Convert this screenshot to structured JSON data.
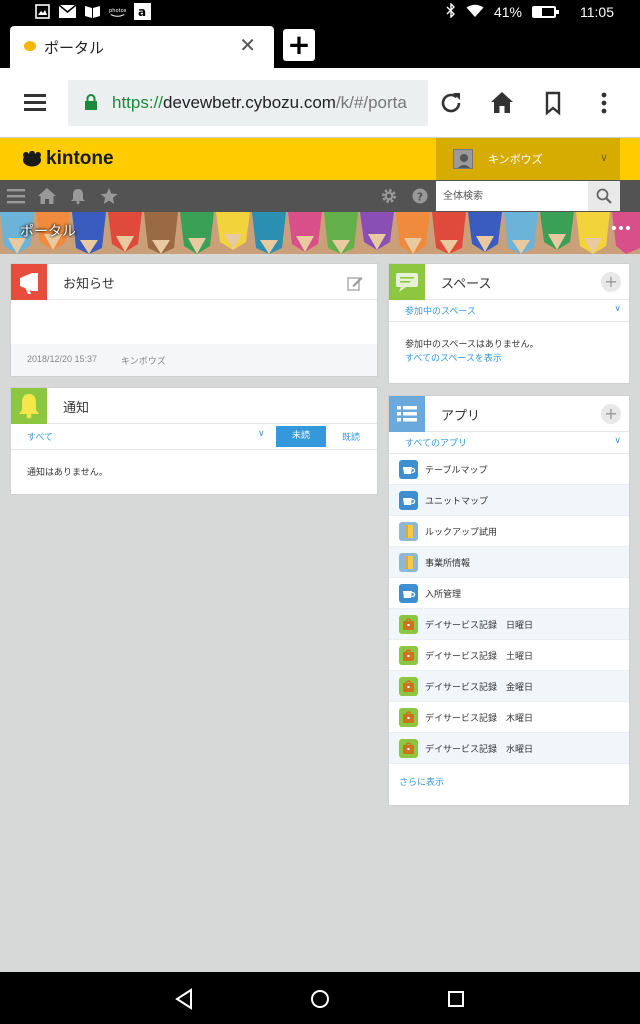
{
  "status_bar": {
    "battery_percent": "41%",
    "battery_level": 0.41,
    "time": "11:05"
  },
  "browser": {
    "tab_title": "ポータル",
    "url_scheme": "https://",
    "url_host": "devewbetr.cybozu.com",
    "url_path": "/k/#/porta"
  },
  "kintone": {
    "logo_text": "kintone",
    "user_name": "キンボウズ",
    "search_placeholder": "全体検索",
    "banner_title": "ポータル"
  },
  "notice": {
    "title": "お知らせ",
    "date": "2018/12/20 15:37",
    "author": "キンボウズ"
  },
  "notifications": {
    "title": "通知",
    "filter": "すべて",
    "tab_unread": "未読",
    "tab_read": "既読",
    "empty_message": "通知はありません。"
  },
  "spaces": {
    "title": "スペース",
    "filter": "参加中のスペース",
    "empty_message": "参加中のスペースはありません。",
    "show_all_link": "すべてのスペースを表示"
  },
  "apps": {
    "title": "アプリ",
    "filter": "すべてのアプリ",
    "items": [
      {
        "name": "テーブルマップ",
        "icon": "cup-icon"
      },
      {
        "name": "ユニットマップ",
        "icon": "cup-icon"
      },
      {
        "name": "ルックアップ試用",
        "icon": "door-icon"
      },
      {
        "name": "事業所情報",
        "icon": "door-icon"
      },
      {
        "name": "入所管理",
        "icon": "cup-icon"
      },
      {
        "name": "デイサービス記録　日曜日",
        "icon": "bag-icon"
      },
      {
        "name": "デイサービス記録　土曜日",
        "icon": "bag-icon"
      },
      {
        "name": "デイサービス記録　金曜日",
        "icon": "bag-icon"
      },
      {
        "name": "デイサービス記録　木曜日",
        "icon": "bag-icon"
      },
      {
        "name": "デイサービス記録　水曜日",
        "icon": "bag-icon"
      }
    ],
    "more_link": "さらに表示"
  },
  "colors": {
    "kintone_yellow": "#ffcc00",
    "user_menu": "#d6ac00",
    "nav_gray": "#535353",
    "link_blue": "#3498db",
    "notice_red": "#e74c3c",
    "notify_green": "#8dc63f",
    "space_green": "#8dc63f",
    "app_blue": "#6aa9dc"
  }
}
